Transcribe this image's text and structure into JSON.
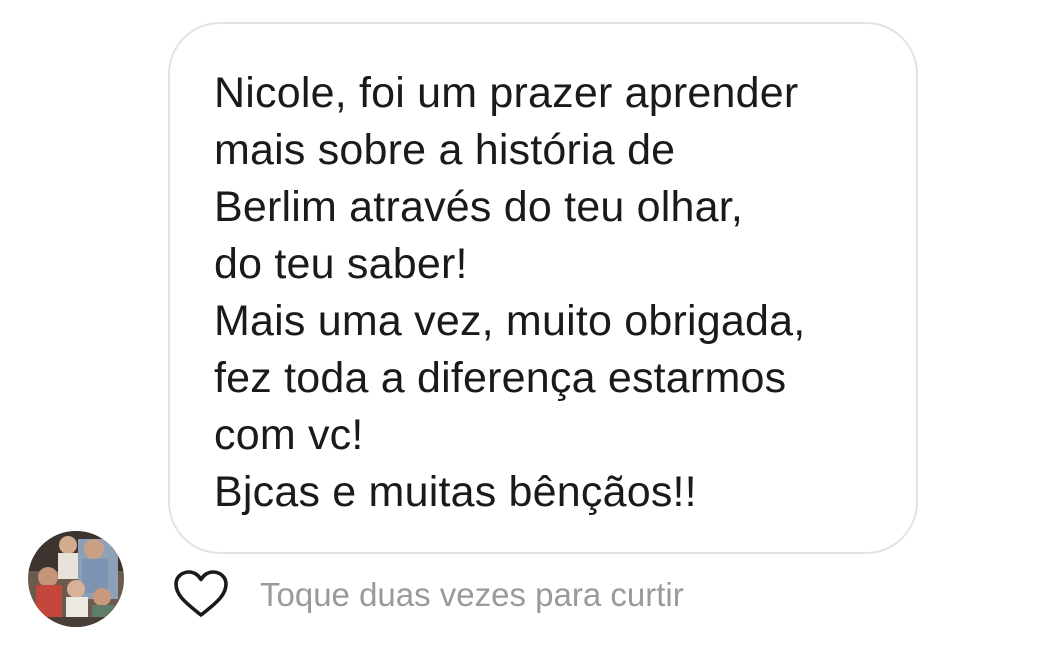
{
  "message": {
    "lines": [
      "Nicole, foi um prazer aprender",
      "mais sobre a história de",
      "Berlim através do teu olhar,",
      "do teu saber!",
      "Mais uma vez, muito obrigada,",
      "fez toda a diferença estarmos",
      "com vc!",
      "Bjcas e muitas bênçãos!!"
    ]
  },
  "footer": {
    "like_icon": "heart-outline-icon",
    "like_hint": "Toque duas vezes para curtir"
  },
  "colors": {
    "bubble_border": "#e3e3e3",
    "message_text": "#1a1a1a",
    "hint_text": "#9a9a9a",
    "icon": "#1a1a1a"
  }
}
